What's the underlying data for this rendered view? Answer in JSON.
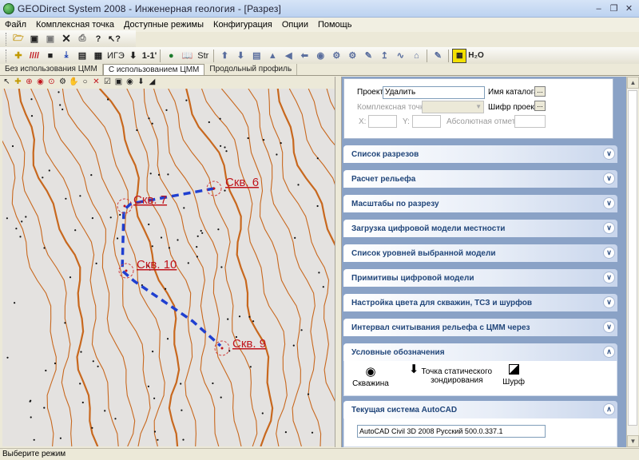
{
  "window": {
    "title": "GEODirect System 2008 - Инженерная геология - [Разрез]"
  },
  "menu": [
    "Файл",
    "Комплексная точка",
    "Доступные режимы",
    "Конфигурация",
    "Опции",
    "Помощь"
  ],
  "toolbar2": {
    "ige": "ИГЭ",
    "section": "1-1'",
    "str": "Str",
    "h2o": "H₂O"
  },
  "tabs": [
    "Без использования ЦММ",
    "С использованием ЦММ",
    "Продольный профиль"
  ],
  "map": {
    "wells": [
      {
        "label": "Скв. 6"
      },
      {
        "label": "Скв. 7"
      },
      {
        "label": "Скв. 10"
      },
      {
        "label": "Скв. 9"
      }
    ]
  },
  "form": {
    "project_label": "Проект:",
    "project_value": "Удалить",
    "catalog_label": "Имя каталога",
    "complex_point_label": "Комплексная точка:",
    "cipher_label": "Шифр проекта",
    "x_label": "X:",
    "y_label": "Y:",
    "abs_label": "Абсолютная отметка:",
    "dots": "..."
  },
  "sections": [
    "Список разрезов",
    "Расчет рельефа",
    "Масштабы по разрезу",
    "Загрузка цифровой модели местности",
    "Список уровней выбранной модели",
    "Примитивы цифровой модели",
    "Настройка цвета для скважин, ТСЗ и шурфов",
    "Интервал считывания рельефа с ЦММ через",
    "Условные обозначения",
    "Текущая система AutoCAD"
  ],
  "legend": {
    "well": "Скважина",
    "tsz_line1": "Точка статического",
    "tsz_line2": "зондирования",
    "pit": "Шурф"
  },
  "autocad": {
    "value": "AutoCAD Civil 3D 2008 Русский 500.0.337.1"
  },
  "status": {
    "text": "Выберите режим"
  },
  "colors": {
    "contour": "#c8681e",
    "route": "#1f3fd0",
    "well_label": "#c0141c",
    "section_bar": "#8aa2c6"
  }
}
